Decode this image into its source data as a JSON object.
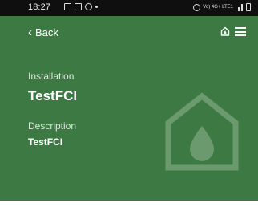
{
  "status_bar": {
    "time": "18:27",
    "network_label": "Vo) 4G+ LTE1"
  },
  "nav": {
    "back_label": "Back"
  },
  "installation": {
    "label": "Installation",
    "value": "TestFCI"
  },
  "description": {
    "label": "Description",
    "value": "TestFCI"
  },
  "colors": {
    "background": "#3d7a43",
    "watermark": "#6a9a6e",
    "status_bar": "#0f0f0f"
  },
  "icons": {
    "back": "chevron-left-icon",
    "home": "home-icon",
    "menu": "hamburger-menu-icon",
    "watermark": "water-drop-house-icon"
  }
}
